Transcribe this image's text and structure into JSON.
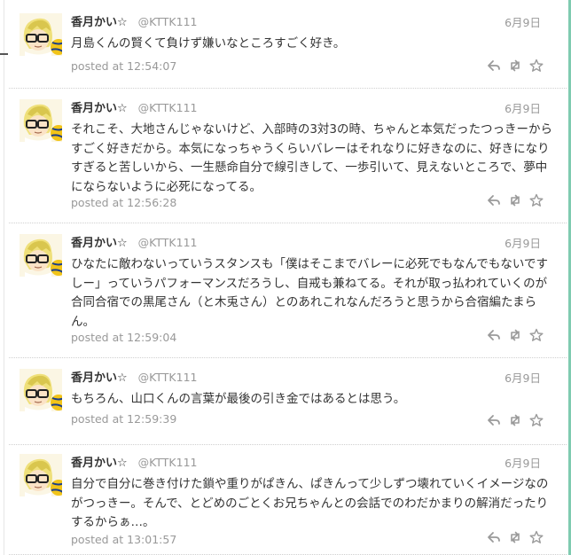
{
  "tweets": [
    {
      "name": "香月かい☆",
      "handle": "@KTTK111",
      "date": "6月9日",
      "text": "月島くんの賢くて負けず嫌いなところすごく好き。",
      "posted": "posted at 12:54:07"
    },
    {
      "name": "香月かい☆",
      "handle": "@KTTK111",
      "date": "6月9日",
      "text": "それこそ、大地さんじゃないけど、入部時の3対3の時、ちゃんと本気だったつっきーからすごく好きだから。本気になっちゃうくらいバレーはそれなりに好きなのに、好きになりすぎると苦しいから、一生懸命自分で線引きして、一歩引いて、見えないところで、夢中にならないように必死になってる。",
      "posted": "posted at 12:56:28"
    },
    {
      "name": "香月かい☆",
      "handle": "@KTTK111",
      "date": "6月9日",
      "text": "ひなたに敵わないっていうスタンスも「僕はそこまでバレーに必死でもなんでもないですしー」っていうパフォーマンスだろうし、自戒も兼ねてる。それが取っ払われていくのが合同合宿での黒尾さん（と木兎さん）とのあれこれなんだろうと思うから合宿編たまらん。",
      "posted": "posted at 12:59:04"
    },
    {
      "name": "香月かい☆",
      "handle": "@KTTK111",
      "date": "6月9日",
      "text": "もちろん、山口くんの言葉が最後の引き金ではあるとは思う。",
      "posted": "posted at 12:59:39"
    },
    {
      "name": "香月かい☆",
      "handle": "@KTTK111",
      "date": "6月9日",
      "text": "自分で自分に巻き付けた鎖や重りがぱきん、ぱきんって少しずつ壊れていくイメージなのがつっきー。そんで、とどめのごとくお兄ちゃんとの会話でのわだかまりの解消だったりするからぁ…。",
      "posted": "posted at 13:01:57"
    }
  ],
  "icons": {
    "reply": "reply-icon",
    "retweet": "retweet-icon",
    "favorite": "star-icon"
  },
  "colors": {
    "accent_border": "#7fcbb0",
    "text": "#333333",
    "muted": "#999999"
  }
}
